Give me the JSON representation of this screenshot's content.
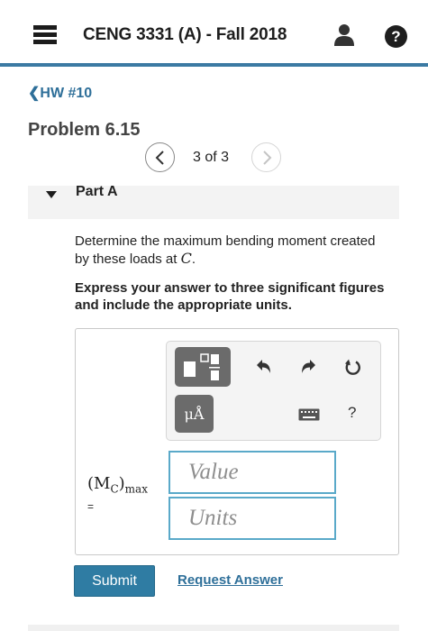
{
  "header": {
    "course_title": "CENG 3331 (A) - Fall 2018",
    "menu_icon": "hamburger-menu-icon",
    "user_icon": "user-icon",
    "help_icon": "help-icon",
    "help_glyph": "?",
    "accent_color": "#3b7aa3"
  },
  "nav": {
    "back_label": "HW #10",
    "problem_title": "Problem 6.15",
    "pager": {
      "current": 3,
      "total": 3,
      "label": "3 of 3"
    }
  },
  "part": {
    "label": "Part A",
    "question_text": "Determine the maximum bending moment created by these loads at",
    "question_point": "C",
    "question_end": ".",
    "instruction": "Express your answer to three significant figures and include the appropriate units."
  },
  "answer": {
    "toolbar": {
      "template_icon": "templates-icon",
      "units_label": "μÅ",
      "undo_icon": "undo-icon",
      "redo_icon": "redo-icon",
      "reset_icon": "reset-icon",
      "keyboard_icon": "keyboard-icon",
      "help_label": "?"
    },
    "label_main": "(M",
    "label_sub_c": "C",
    "label_close": ")",
    "label_sub_max": "max",
    "label_equals": "=",
    "value_placeholder": "Value",
    "units_placeholder": "Units"
  },
  "actions": {
    "submit_label": "Submit",
    "request_answer_label": "Request Answer",
    "submit_color": "#2f7ca3"
  }
}
